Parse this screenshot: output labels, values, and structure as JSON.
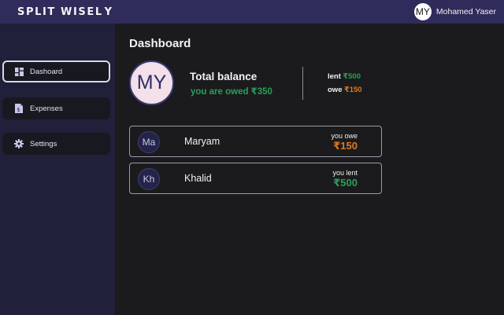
{
  "app": {
    "logo": "SPLIT  WISEL",
    "logo_mark": "Y"
  },
  "user": {
    "initials": "MY",
    "name": "Mohamed Yaser"
  },
  "sidebar": {
    "items": [
      {
        "label": "Dashoard",
        "icon": "dashboard-icon",
        "active": true
      },
      {
        "label": "Expenses",
        "icon": "receipt-icon",
        "active": false
      },
      {
        "label": "Settings",
        "icon": "gear-icon",
        "active": false
      }
    ]
  },
  "dashboard": {
    "title": "Dashboard",
    "avatar_initials": "MY",
    "balance_title": "Total balance",
    "balance_subtitle": "you are owed ₹350",
    "lent_label": "lent",
    "lent_amount": "₹500",
    "owe_label": "owe",
    "owe_amount": "₹150"
  },
  "friends": [
    {
      "initials": "Ma",
      "name": "Maryam",
      "status": "you owe",
      "amount": "₹150",
      "tone": "orange"
    },
    {
      "initials": "Kh",
      "name": "Khalid",
      "status": "you lent",
      "amount": "₹500",
      "tone": "green"
    }
  ],
  "colors": {
    "topbar": "#2f2b5b",
    "sidebar": "#20203a",
    "background": "#1b1b1d",
    "positive": "#27a15a",
    "negative": "#e07a1f"
  }
}
